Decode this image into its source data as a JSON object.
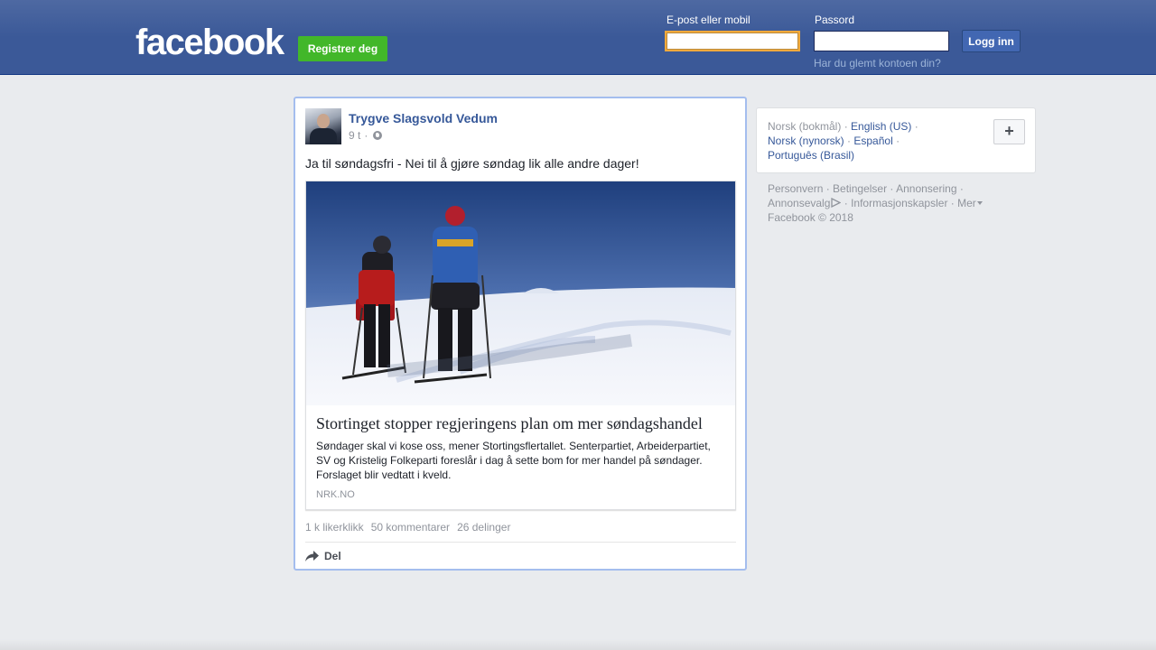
{
  "header": {
    "logo": "facebook",
    "register_label": "Registrer deg",
    "email_label": "E-post eller mobil",
    "password_label": "Passord",
    "login_label": "Logg inn",
    "forgot_label": "Har du glemt kontoen din?",
    "colors": {
      "bar": "#3b5998",
      "register": "#42b72a"
    }
  },
  "post": {
    "author": "Trygve Slagsvold Vedum",
    "time": "9 t",
    "meta_sep": "·",
    "privacy_icon": "globe-icon",
    "text": "Ja til søndagsfri - Nei til å gjøre søndag lik alle andre dager!",
    "link": {
      "title": "Stortinget stopper regjeringens plan om mer søndagshandel",
      "description": "Søndager skal vi kose oss, mener Stortingsflertallet. Senterpartiet, Arbeiderpartiet, SV og Kristelig Folkeparti foreslår i dag å sette bom for mer handel på søndager. Forslaget blir vedtatt i kveld.",
      "source": "NRK.NO"
    },
    "stats": {
      "likes": "1 k likerklikk",
      "comments": "50 kommentarer",
      "shares": "26 delinger"
    },
    "share_label": "Del",
    "share_icon": "share-arrow-icon"
  },
  "languages": {
    "current": "Norsk (bokmål)",
    "options": [
      "English (US)",
      "Norsk (nynorsk)",
      "Español",
      "Português (Brasil)"
    ],
    "more_icon": "plus-icon",
    "plus_label": "+"
  },
  "footer": {
    "links": [
      "Personvern",
      "Betingelser",
      "Annonsering",
      "Annonsevalg",
      "Informasjonskapsler",
      "Mer"
    ],
    "copyright": "Facebook © 2018",
    "adchoices_icon": "adchoices-icon"
  }
}
